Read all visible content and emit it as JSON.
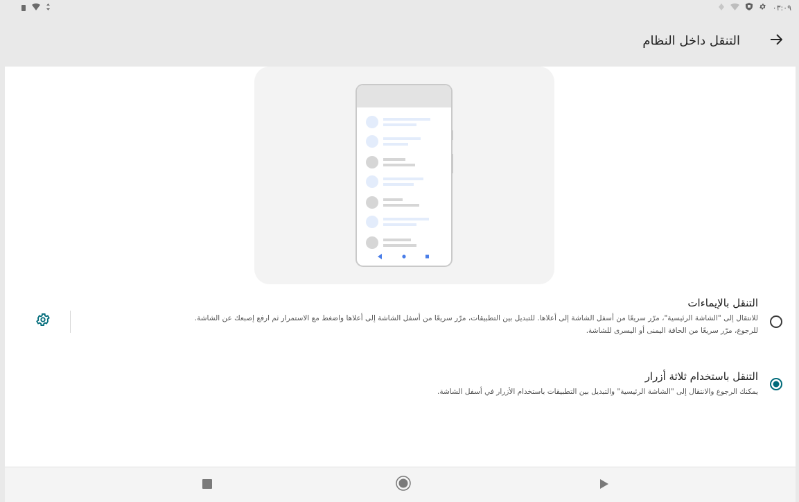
{
  "status_bar": {
    "time": "٠٣:٠٩",
    "icons_right": [
      "settings-icon",
      "shield-icon",
      "wifi-icon",
      "location-icon"
    ],
    "icons_left": [
      "battery-icon",
      "wifi-signal-icon",
      "data-activity-icon"
    ]
  },
  "toolbar": {
    "title": "التنقل داخل النظام",
    "back_icon": "arrow-back-icon"
  },
  "options": [
    {
      "title": "التنقل بالإيماءات",
      "summary_line1": "للانتقال إلى \"الشاشة الرئيسية\"، مرّر سريعًا من أسفل الشاشة إلى أعلاها. للتبديل بين التطبيقات، مرّر سريعًا من أسفل الشاشة إلى أعلاها واضغط مع الاستمرار ثم ارفع إصبعك عن الشاشة.",
      "summary_line2": "للرجوع، مرّر سريعًا من الحافة اليمنى أو اليسرى للشاشة.",
      "selected": false
    },
    {
      "title": "التنقل باستخدام ثلاثة أزرار",
      "summary_line1": "يمكنك الرجوع والانتقال إلى \"الشاشة الرئيسية\" والتبديل بين التطبيقات باستخدام الأزرار في أسفل الشاشة.",
      "selected": true
    }
  ],
  "colors": {
    "accent": "#006b7a",
    "status_bar_bg": "#e9e9e9",
    "illustration_bg": "#f3f3f3"
  },
  "nav_bar": {
    "buttons": [
      "recents-icon",
      "home-icon",
      "back-triangle-icon"
    ]
  }
}
